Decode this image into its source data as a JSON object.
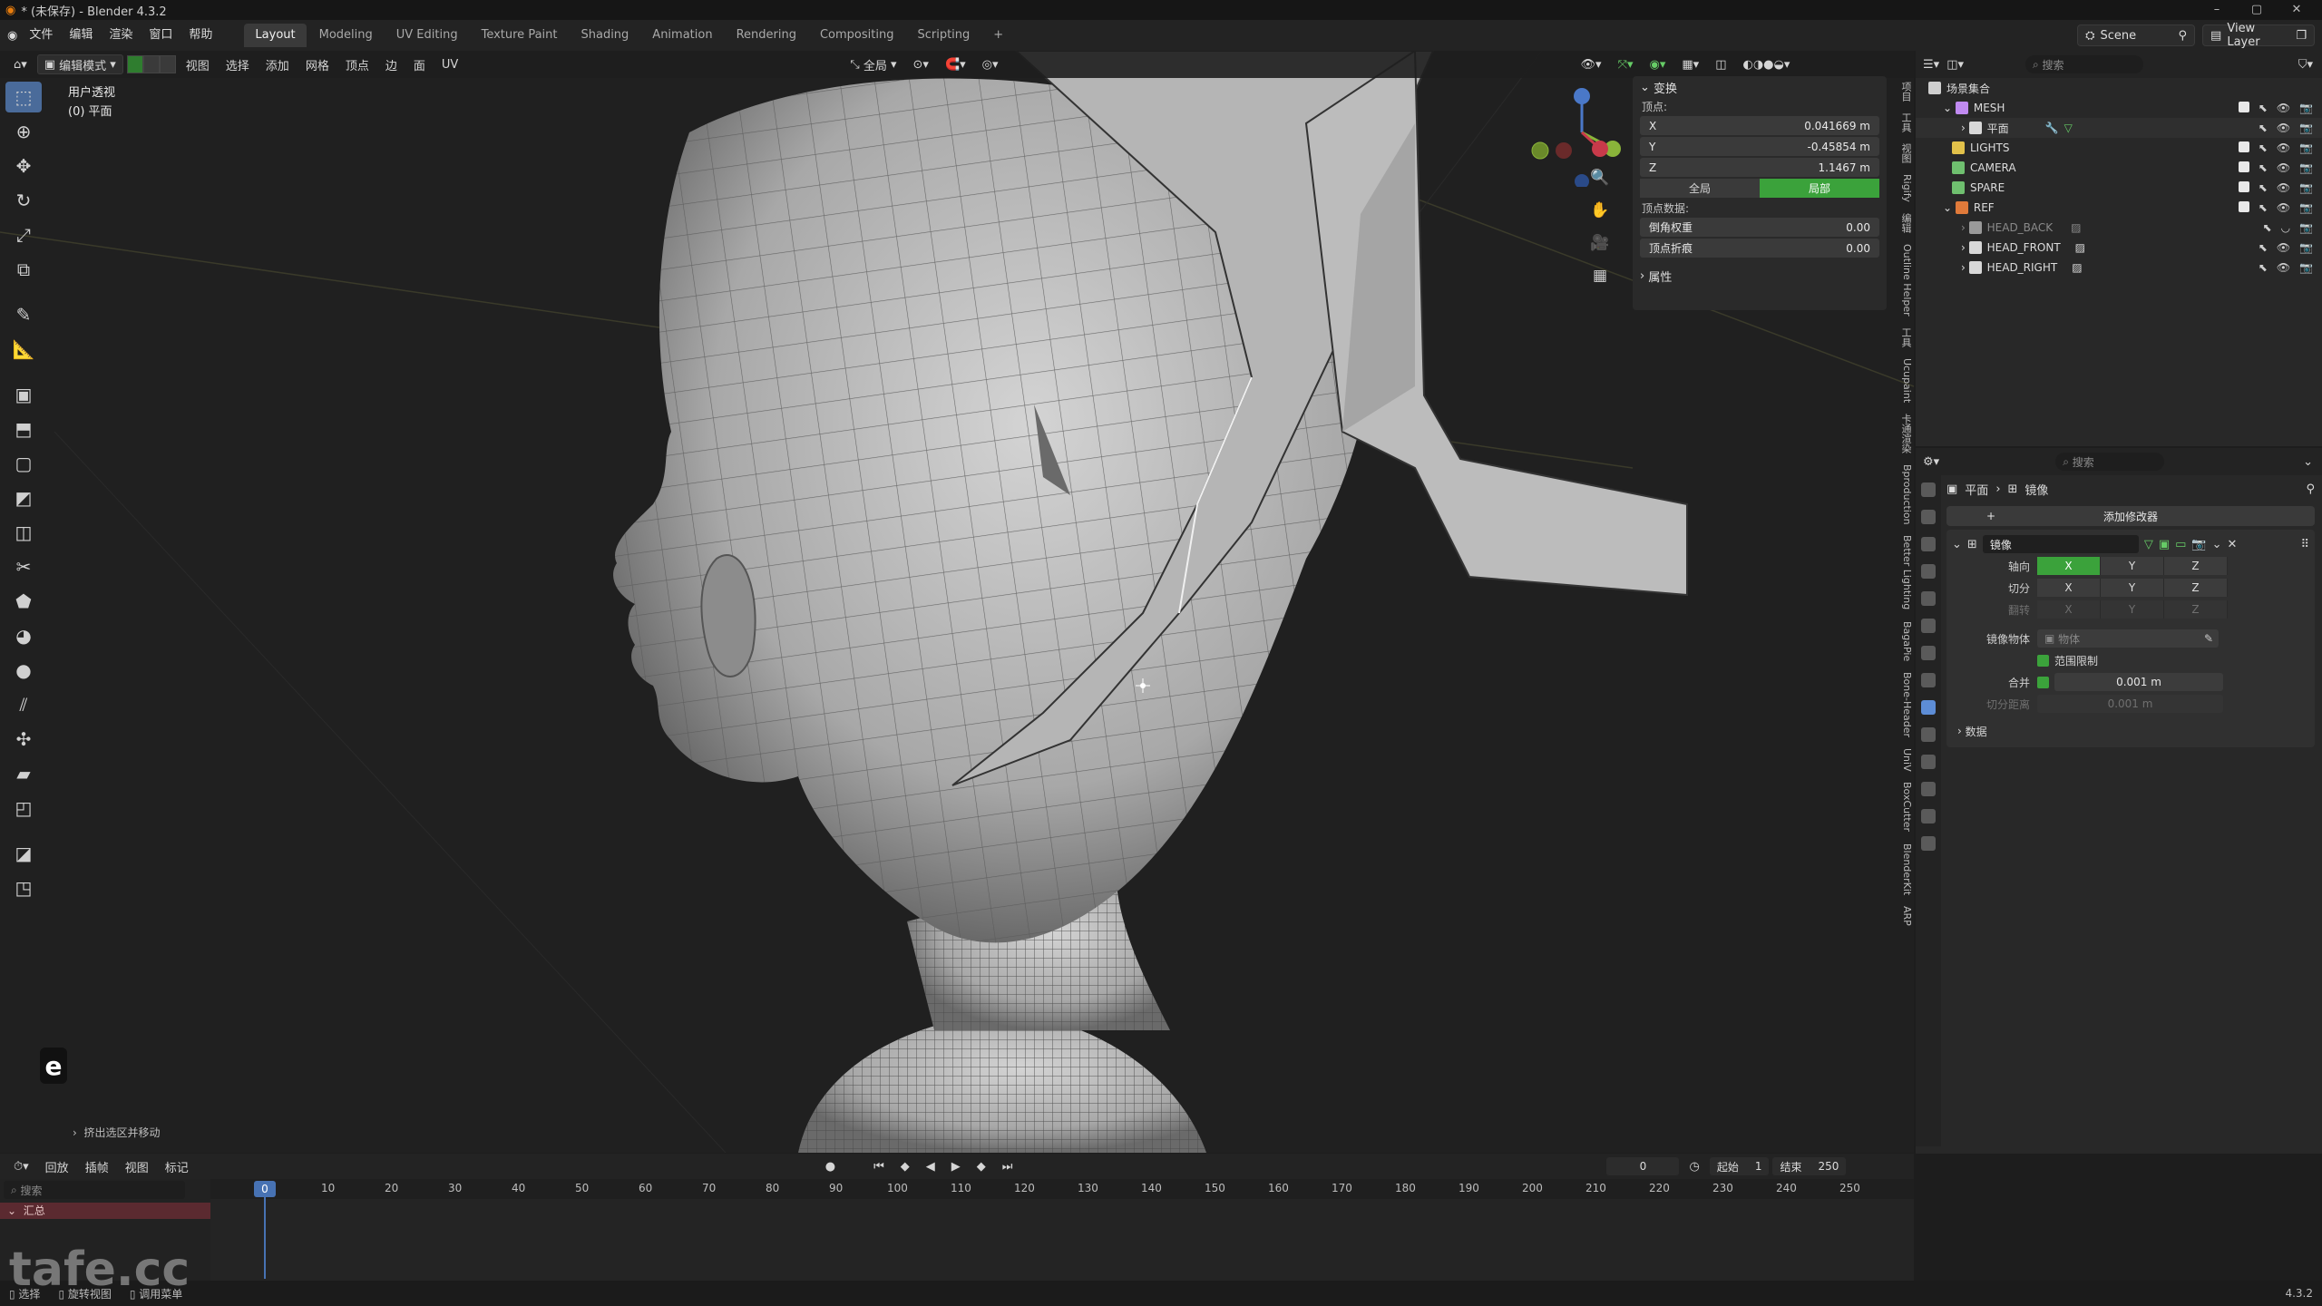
{
  "title": "* (未保存) - Blender 4.3.2",
  "menus": [
    "文件",
    "编辑",
    "渲染",
    "窗口",
    "帮助"
  ],
  "workspaces": [
    "Layout",
    "Modeling",
    "UV Editing",
    "Texture Paint",
    "Shading",
    "Animation",
    "Rendering",
    "Compositing",
    "Scripting",
    "+"
  ],
  "active_workspace": "Layout",
  "scene": "Scene",
  "view_layer": "View Layer",
  "viewport_header": {
    "mode": "编辑模式",
    "menus": [
      "视图",
      "选择",
      "添加",
      "网格",
      "顶点",
      "边",
      "面",
      "UV"
    ],
    "transform_orientation": "全局"
  },
  "viewport": {
    "view_name": "用户透视",
    "object_name": "(0) 平面",
    "key_hint": "e",
    "last_operator": "挤出选区并移动"
  },
  "npanel": {
    "transform_title": "变换",
    "vertex_label": "顶点:",
    "x_label": "X",
    "x_value": "0.041669 m",
    "y_label": "Y",
    "y_value": "-0.45854 m",
    "z_label": "Z",
    "z_value": "1.1467 m",
    "global_label": "全局",
    "local_label": "局部",
    "vertex_data_label": "顶点数据:",
    "bevel_weight_label": "倒角权重",
    "bevel_weight_value": "0.00",
    "crease_label": "顶点折痕",
    "crease_value": "0.00",
    "properties_title": "属性"
  },
  "ntabs": [
    "项目",
    "工具",
    "视图",
    "Rigify",
    "编辑",
    "Outline Helper",
    "工具",
    "Ucupaint",
    "卡通渲染",
    "Bproduction",
    "Better Lighting",
    "BagaPie",
    "Bone-Header",
    "UniV",
    "BoxCutter",
    "BlenderKit",
    "ARP"
  ],
  "outliner": {
    "search_placeholder": "搜索",
    "root": "场景集合",
    "rows": [
      {
        "name": "MESH",
        "color": "#c08af0"
      },
      {
        "name": "平面",
        "color": "#d8d8d8"
      },
      {
        "name": "LIGHTS",
        "color": "#e2c14a"
      },
      {
        "name": "CAMERA",
        "color": "#6fbf6f"
      },
      {
        "name": "SPARE",
        "color": "#6fbf6f"
      },
      {
        "name": "REF",
        "color": "#e07a3a"
      },
      {
        "name": "HEAD_BACK",
        "color": "#9a9a9a"
      },
      {
        "name": "HEAD_FRONT",
        "color": "#d8d8d8"
      },
      {
        "name": "HEAD_RIGHT",
        "color": "#d8d8d8"
      }
    ]
  },
  "properties": {
    "search_placeholder": "搜索",
    "breadcrumb_object": "平面",
    "breadcrumb_modifier": "镜像",
    "add_modifier": "添加修改器",
    "modifier_name": "镜像",
    "axis_label": "轴向",
    "bisect_label": "切分",
    "flip_label": "翻转",
    "axis_x": "X",
    "axis_y": "Y",
    "axis_z": "Z",
    "mirror_object_label": "镜像物体",
    "mirror_object_placeholder": "物体",
    "clipping_label": "范围限制",
    "merge_label": "合并",
    "merge_value": "0.001 m",
    "bisect_distance_label": "切分距离",
    "bisect_distance_value": "0.001 m",
    "data_label": "数据"
  },
  "timeline": {
    "menus": [
      "回放",
      "插帧",
      "视图",
      "标记"
    ],
    "current_frame": "0",
    "start_label": "起始",
    "start_value": "1",
    "end_label": "结束",
    "end_value": "250",
    "playhead_frame": "0",
    "ticks": [
      "10",
      "20",
      "30",
      "40",
      "50",
      "60",
      "70",
      "80",
      "90",
      "100",
      "110",
      "120",
      "130",
      "140",
      "150",
      "160",
      "170",
      "180",
      "190",
      "200",
      "210",
      "220",
      "230",
      "240",
      "250"
    ],
    "search_placeholder": "搜索",
    "summary": "汇总"
  },
  "statusbar": {
    "select": "选择",
    "rotate": "旋转视图",
    "menu": "调用菜单",
    "version": "4.3.2"
  },
  "watermark": "tafe.cc"
}
